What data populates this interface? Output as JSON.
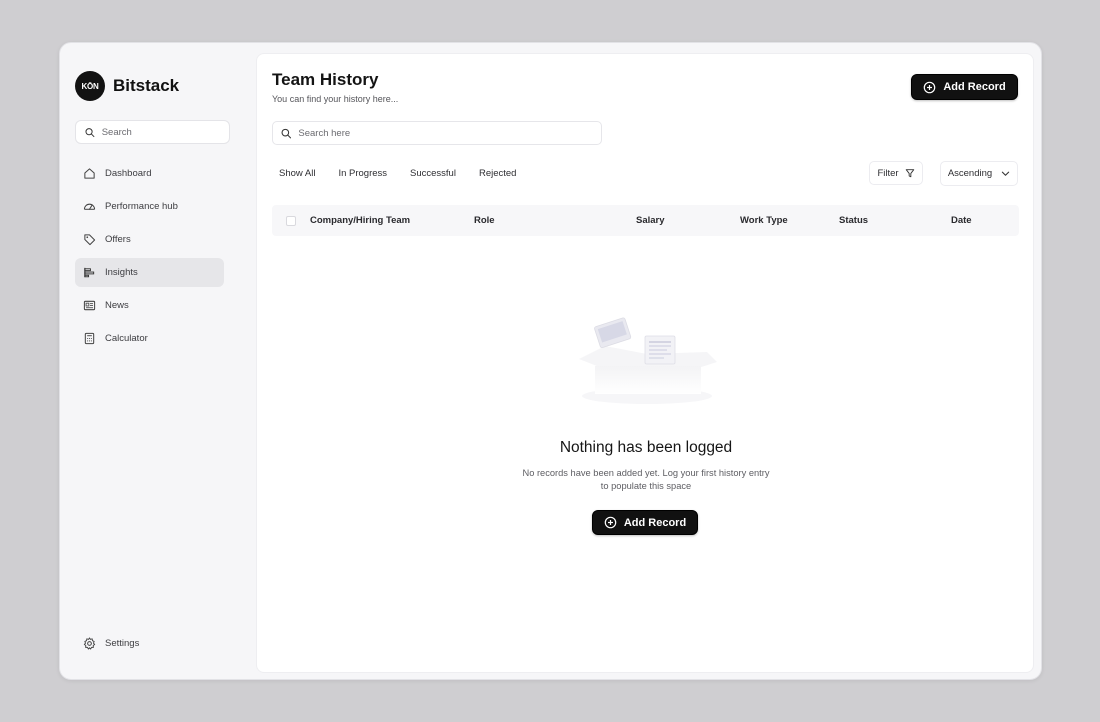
{
  "brand": {
    "logo_text": "KŌN",
    "name": "Bitstack"
  },
  "sidebar": {
    "search_placeholder": "Search",
    "items": [
      {
        "label": "Dashboard",
        "icon": "home-icon"
      },
      {
        "label": "Performance hub",
        "icon": "gauge-icon"
      },
      {
        "label": "Offers",
        "icon": "tag-icon"
      },
      {
        "label": "Insights",
        "icon": "chart-bars-icon",
        "active": true
      },
      {
        "label": "News",
        "icon": "newspaper-icon"
      },
      {
        "label": "Calculator",
        "icon": "calculator-icon"
      }
    ],
    "settings_label": "Settings"
  },
  "header": {
    "title": "Team History",
    "subtitle": "You can find your history here...",
    "add_button_label": "Add Record"
  },
  "search": {
    "placeholder": "Search here"
  },
  "tabs": [
    "Show All",
    "In Progress",
    "Successful",
    "Rejected"
  ],
  "filter_label": "Filter",
  "sort": {
    "selected": "Ascending"
  },
  "table": {
    "columns": [
      "Company/Hiring Team",
      "Role",
      "Salary",
      "Work Type",
      "Status",
      "Date"
    ],
    "rows": []
  },
  "empty_state": {
    "title": "Nothing has been logged",
    "description": "No records have been added yet. Log your first history entry to populate this space",
    "button_label": "Add Record"
  }
}
